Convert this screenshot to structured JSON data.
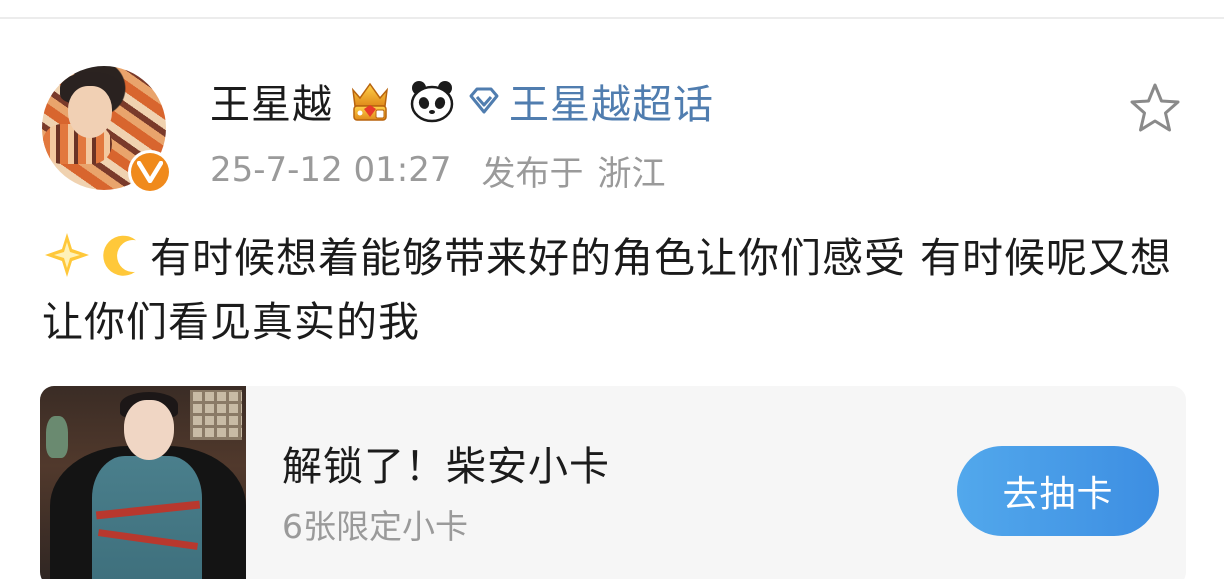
{
  "post": {
    "author": {
      "name": "王星越",
      "avatar_icon": "avatar-photo",
      "verified_icon": "verified-v-icon",
      "verified_color": "#f08a1c",
      "badges": [
        "crown-badge-icon",
        "panda-icon"
      ]
    },
    "topic": {
      "icon": "diamond-icon",
      "label": "王星越超话",
      "color": "#507daf"
    },
    "meta": {
      "timestamp": "25-7-12 01:27",
      "location_prefix": "发布于",
      "location": "浙江"
    },
    "favorite_icon": "star-outline-icon",
    "content": {
      "emojis": [
        "sparkle-star-icon",
        "crescent-moon-icon"
      ],
      "text": "有时候想着能够带来好的角色让你们感受 有时候呢又想让你们看见真实的我"
    },
    "card": {
      "thumbnail_icon": "card-thumbnail",
      "title": "解锁了！柴安小卡",
      "subtitle": "6张限定小卡",
      "button_label": "去抽卡",
      "button_color": "#3d8ee2"
    }
  }
}
